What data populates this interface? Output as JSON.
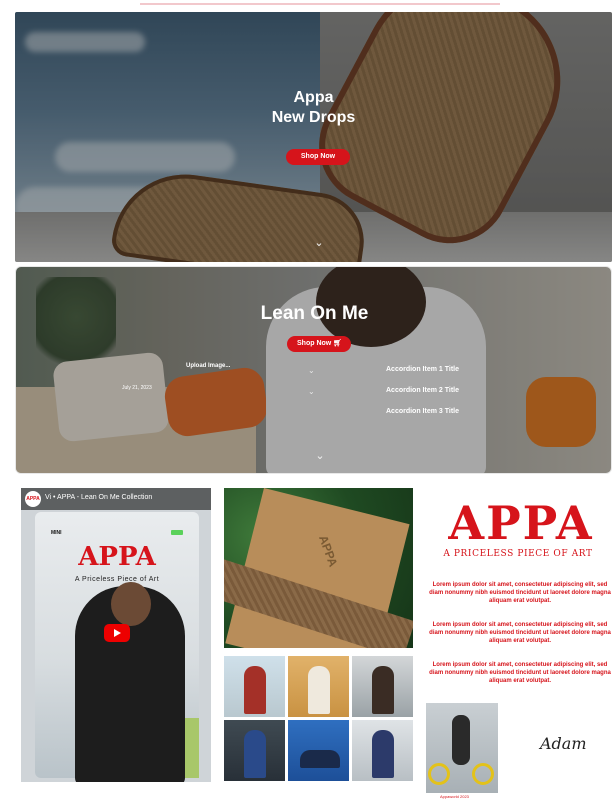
{
  "hero1": {
    "title_line1": "Appa",
    "title_line2": "New Drops",
    "button_label": "Shop Now"
  },
  "hero2": {
    "title": "Lean On Me",
    "button_label": "Shop Now",
    "upload_label": "Upload Image...",
    "date_label": "July 21, 2023",
    "accordion": [
      {
        "title": "Accordion Item 1 Title"
      },
      {
        "title": "Accordion Item 2 Title"
      },
      {
        "title": "Accordion Item 3 Title"
      }
    ]
  },
  "video": {
    "channel_badge": "APPA",
    "title": "Vi • APPA - Lean On Me Collection",
    "brand": "APPA",
    "tagline": "A Priceless Piece of Art",
    "mini_label": "MINI"
  },
  "bigphoto": {
    "box_text": "APPA"
  },
  "brand": {
    "name": "APPA",
    "tagline": "A PRICELESS PIECE OF ART",
    "paragraphs": [
      "Lorem ipsum dolor sit amet, consectetuer adipiscing elit, sed diam nonummy nibh euismod tincidunt ut laoreet dolore magna aliquam erat volutpat.",
      "Lorem ipsum dolor sit amet, consectetuer adipiscing elit, sed diam nonummy nibh euismod tincidunt ut laoreet dolore magna aliquam erat volutpat.",
      "Lorem ipsum dolor sit amet, consectetuer adipiscing elit, sed diam nonummy nibh euismod tincidunt ut laoreet dolore magna aliquam erat volutpat."
    ],
    "caption": "Appaworld 2023",
    "signature": "Adam"
  },
  "icons": {
    "cart": "cart-icon",
    "chevron": "chevron-down-icon",
    "play": "play-icon"
  },
  "colors": {
    "accent": "#d6141b",
    "play": "#ee0000"
  }
}
